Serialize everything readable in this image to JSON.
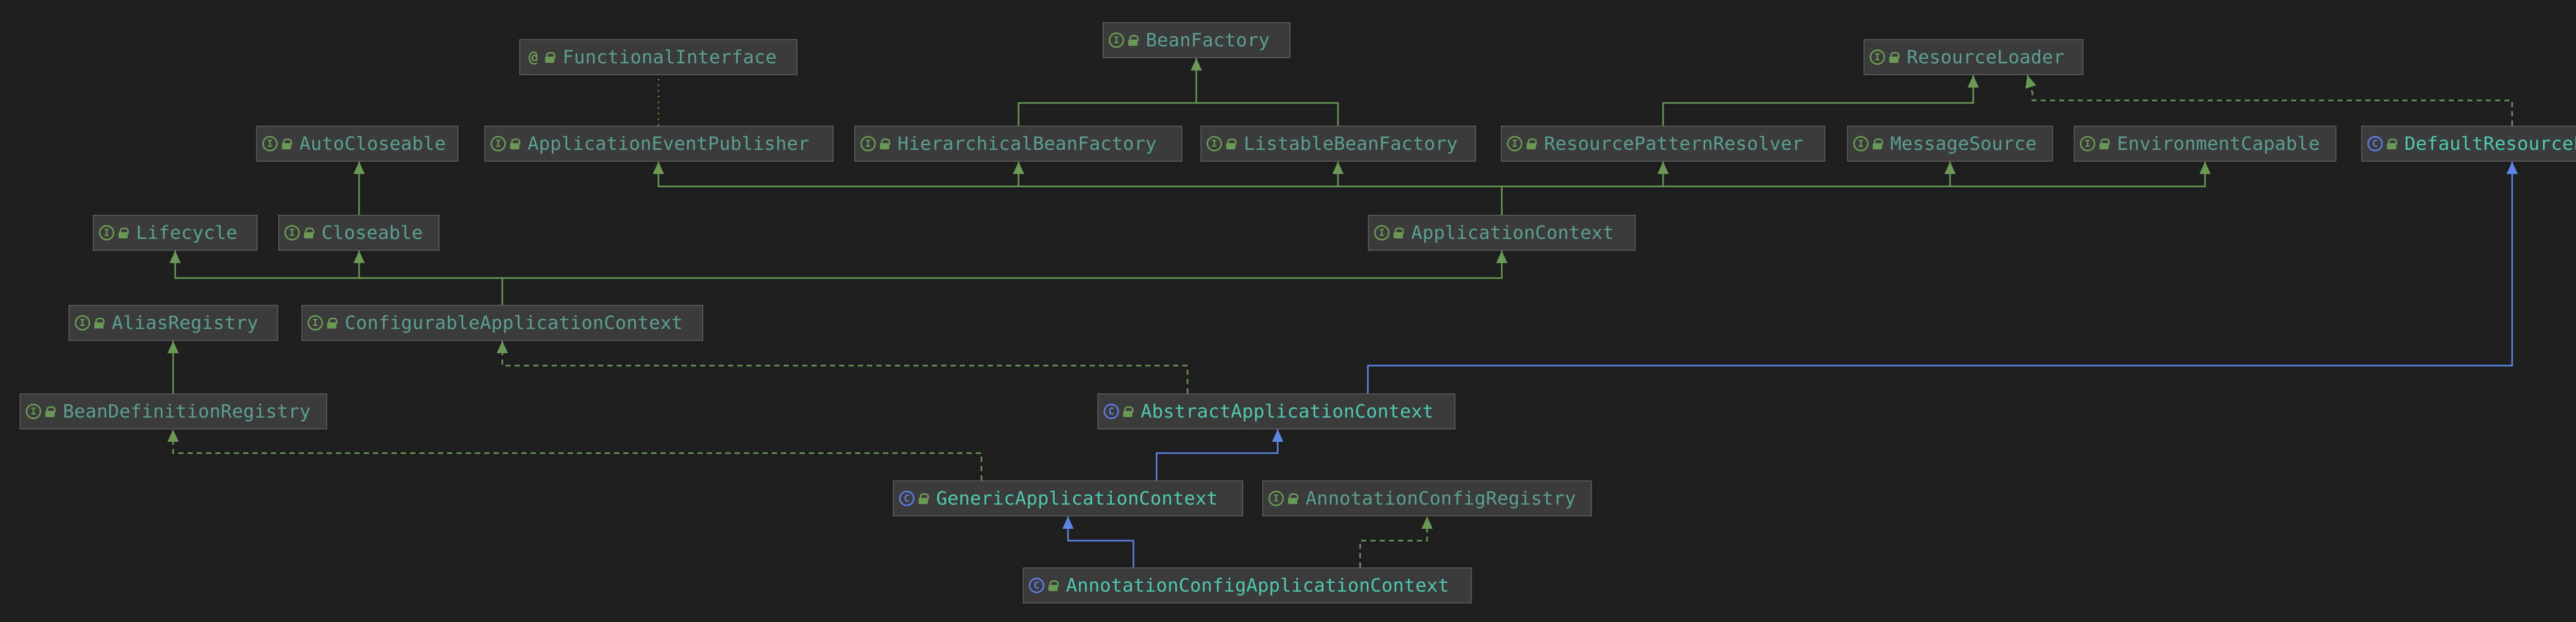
{
  "colors": {
    "background": "#1e1e1e",
    "node_fill": "#3b3b3b",
    "node_border": "#585858",
    "extends_interface": "#6a9955",
    "extends_class": "#5c86e6",
    "interface_text": "#5a9f92",
    "class_text": "#4ec9b0"
  },
  "legend": {
    "interface_icon": "I",
    "class_icon": "C",
    "annotation_icon": "@",
    "lock_icon": "lock-icon"
  },
  "nodes": [
    {
      "id": "FunctionalInterface",
      "label": "FunctionalInterface",
      "kind": "annotation"
    },
    {
      "id": "BeanFactory",
      "label": "BeanFactory",
      "kind": "interface"
    },
    {
      "id": "ResourceLoader",
      "label": "ResourceLoader",
      "kind": "interface"
    },
    {
      "id": "AutoCloseable",
      "label": "AutoCloseable",
      "kind": "interface"
    },
    {
      "id": "ApplicationEventPublisher",
      "label": "ApplicationEventPublisher",
      "kind": "interface"
    },
    {
      "id": "HierarchicalBeanFactory",
      "label": "HierarchicalBeanFactory",
      "kind": "interface"
    },
    {
      "id": "ListableBeanFactory",
      "label": "ListableBeanFactory",
      "kind": "interface"
    },
    {
      "id": "ResourcePatternResolver",
      "label": "ResourcePatternResolver",
      "kind": "interface"
    },
    {
      "id": "MessageSource",
      "label": "MessageSource",
      "kind": "interface"
    },
    {
      "id": "EnvironmentCapable",
      "label": "EnvironmentCapable",
      "kind": "interface"
    },
    {
      "id": "DefaultResourceLoader",
      "label": "DefaultResourceLoader",
      "kind": "class"
    },
    {
      "id": "Lifecycle",
      "label": "Lifecycle",
      "kind": "interface"
    },
    {
      "id": "Closeable",
      "label": "Closeable",
      "kind": "interface"
    },
    {
      "id": "ApplicationContext",
      "label": "ApplicationContext",
      "kind": "interface"
    },
    {
      "id": "AliasRegistry",
      "label": "AliasRegistry",
      "kind": "interface"
    },
    {
      "id": "ConfigurableApplicationContext",
      "label": "ConfigurableApplicationContext",
      "kind": "interface"
    },
    {
      "id": "BeanDefinitionRegistry",
      "label": "BeanDefinitionRegistry",
      "kind": "interface"
    },
    {
      "id": "AbstractApplicationContext",
      "label": "AbstractApplicationContext",
      "kind": "class"
    },
    {
      "id": "GenericApplicationContext",
      "label": "GenericApplicationContext",
      "kind": "class"
    },
    {
      "id": "AnnotationConfigRegistry",
      "label": "AnnotationConfigRegistry",
      "kind": "interface"
    },
    {
      "id": "AnnotationConfigApplicationContext",
      "label": "AnnotationConfigApplicationContext",
      "kind": "class"
    }
  ],
  "edges": [
    {
      "from": "HierarchicalBeanFactory",
      "to": "BeanFactory",
      "type": "extends-interface"
    },
    {
      "from": "ListableBeanFactory",
      "to": "BeanFactory",
      "type": "extends-interface"
    },
    {
      "from": "ResourcePatternResolver",
      "to": "ResourceLoader",
      "type": "extends-interface"
    },
    {
      "from": "DefaultResourceLoader",
      "to": "ResourceLoader",
      "type": "implements"
    },
    {
      "from": "ApplicationEventPublisher",
      "to": "FunctionalInterface",
      "type": "annotated"
    },
    {
      "from": "Closeable",
      "to": "AutoCloseable",
      "type": "extends-interface"
    },
    {
      "from": "ApplicationContext",
      "to": "ApplicationEventPublisher",
      "type": "extends-interface"
    },
    {
      "from": "ApplicationContext",
      "to": "HierarchicalBeanFactory",
      "type": "extends-interface"
    },
    {
      "from": "ApplicationContext",
      "to": "ListableBeanFactory",
      "type": "extends-interface"
    },
    {
      "from": "ApplicationContext",
      "to": "ResourcePatternResolver",
      "type": "extends-interface"
    },
    {
      "from": "ApplicationContext",
      "to": "MessageSource",
      "type": "extends-interface"
    },
    {
      "from": "ApplicationContext",
      "to": "EnvironmentCapable",
      "type": "extends-interface"
    },
    {
      "from": "ConfigurableApplicationContext",
      "to": "Lifecycle",
      "type": "extends-interface"
    },
    {
      "from": "ConfigurableApplicationContext",
      "to": "Closeable",
      "type": "extends-interface"
    },
    {
      "from": "ConfigurableApplicationContext",
      "to": "ApplicationContext",
      "type": "extends-interface"
    },
    {
      "from": "BeanDefinitionRegistry",
      "to": "AliasRegistry",
      "type": "extends-interface"
    },
    {
      "from": "AbstractApplicationContext",
      "to": "ConfigurableApplicationContext",
      "type": "implements"
    },
    {
      "from": "AbstractApplicationContext",
      "to": "DefaultResourceLoader",
      "type": "extends-class"
    },
    {
      "from": "GenericApplicationContext",
      "to": "AbstractApplicationContext",
      "type": "extends-class"
    },
    {
      "from": "GenericApplicationContext",
      "to": "BeanDefinitionRegistry",
      "type": "implements"
    },
    {
      "from": "AnnotationConfigApplicationContext",
      "to": "GenericApplicationContext",
      "type": "extends-class"
    },
    {
      "from": "AnnotationConfigApplicationContext",
      "to": "AnnotationConfigRegistry",
      "type": "implements"
    }
  ]
}
